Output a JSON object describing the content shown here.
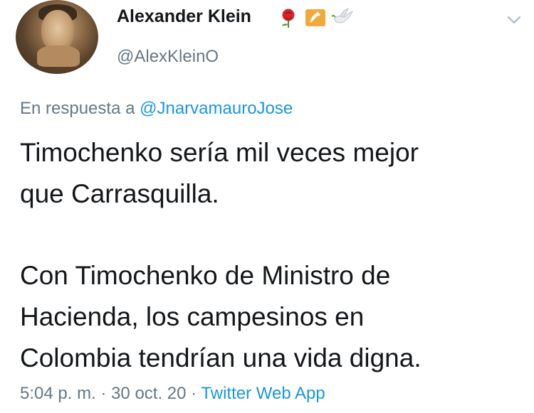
{
  "author": {
    "display_name": "Alexander Klein",
    "handle": "@AlexKleinO",
    "badges": [
      "rose-icon",
      "hammer-sickle-icon",
      "dove-icon"
    ]
  },
  "reply": {
    "prefix": "En respuesta a",
    "mention": "@JnarvamauroJose"
  },
  "tweet": {
    "line1": "Timochenko sería mil veces mejor",
    "line2": "que Carrasquilla.",
    "line3": "Con Timochenko de Ministro de",
    "line4": "Hacienda, los campesinos en",
    "line5": "Colombia tendrían una vida digna."
  },
  "meta": {
    "time": "5:04 p. m.",
    "separator": "·",
    "date": "30 oct. 20",
    "source": "Twitter Web App"
  },
  "colors": {
    "link": "#1b95e0",
    "secondary": "#657786",
    "text": "#14171a"
  }
}
